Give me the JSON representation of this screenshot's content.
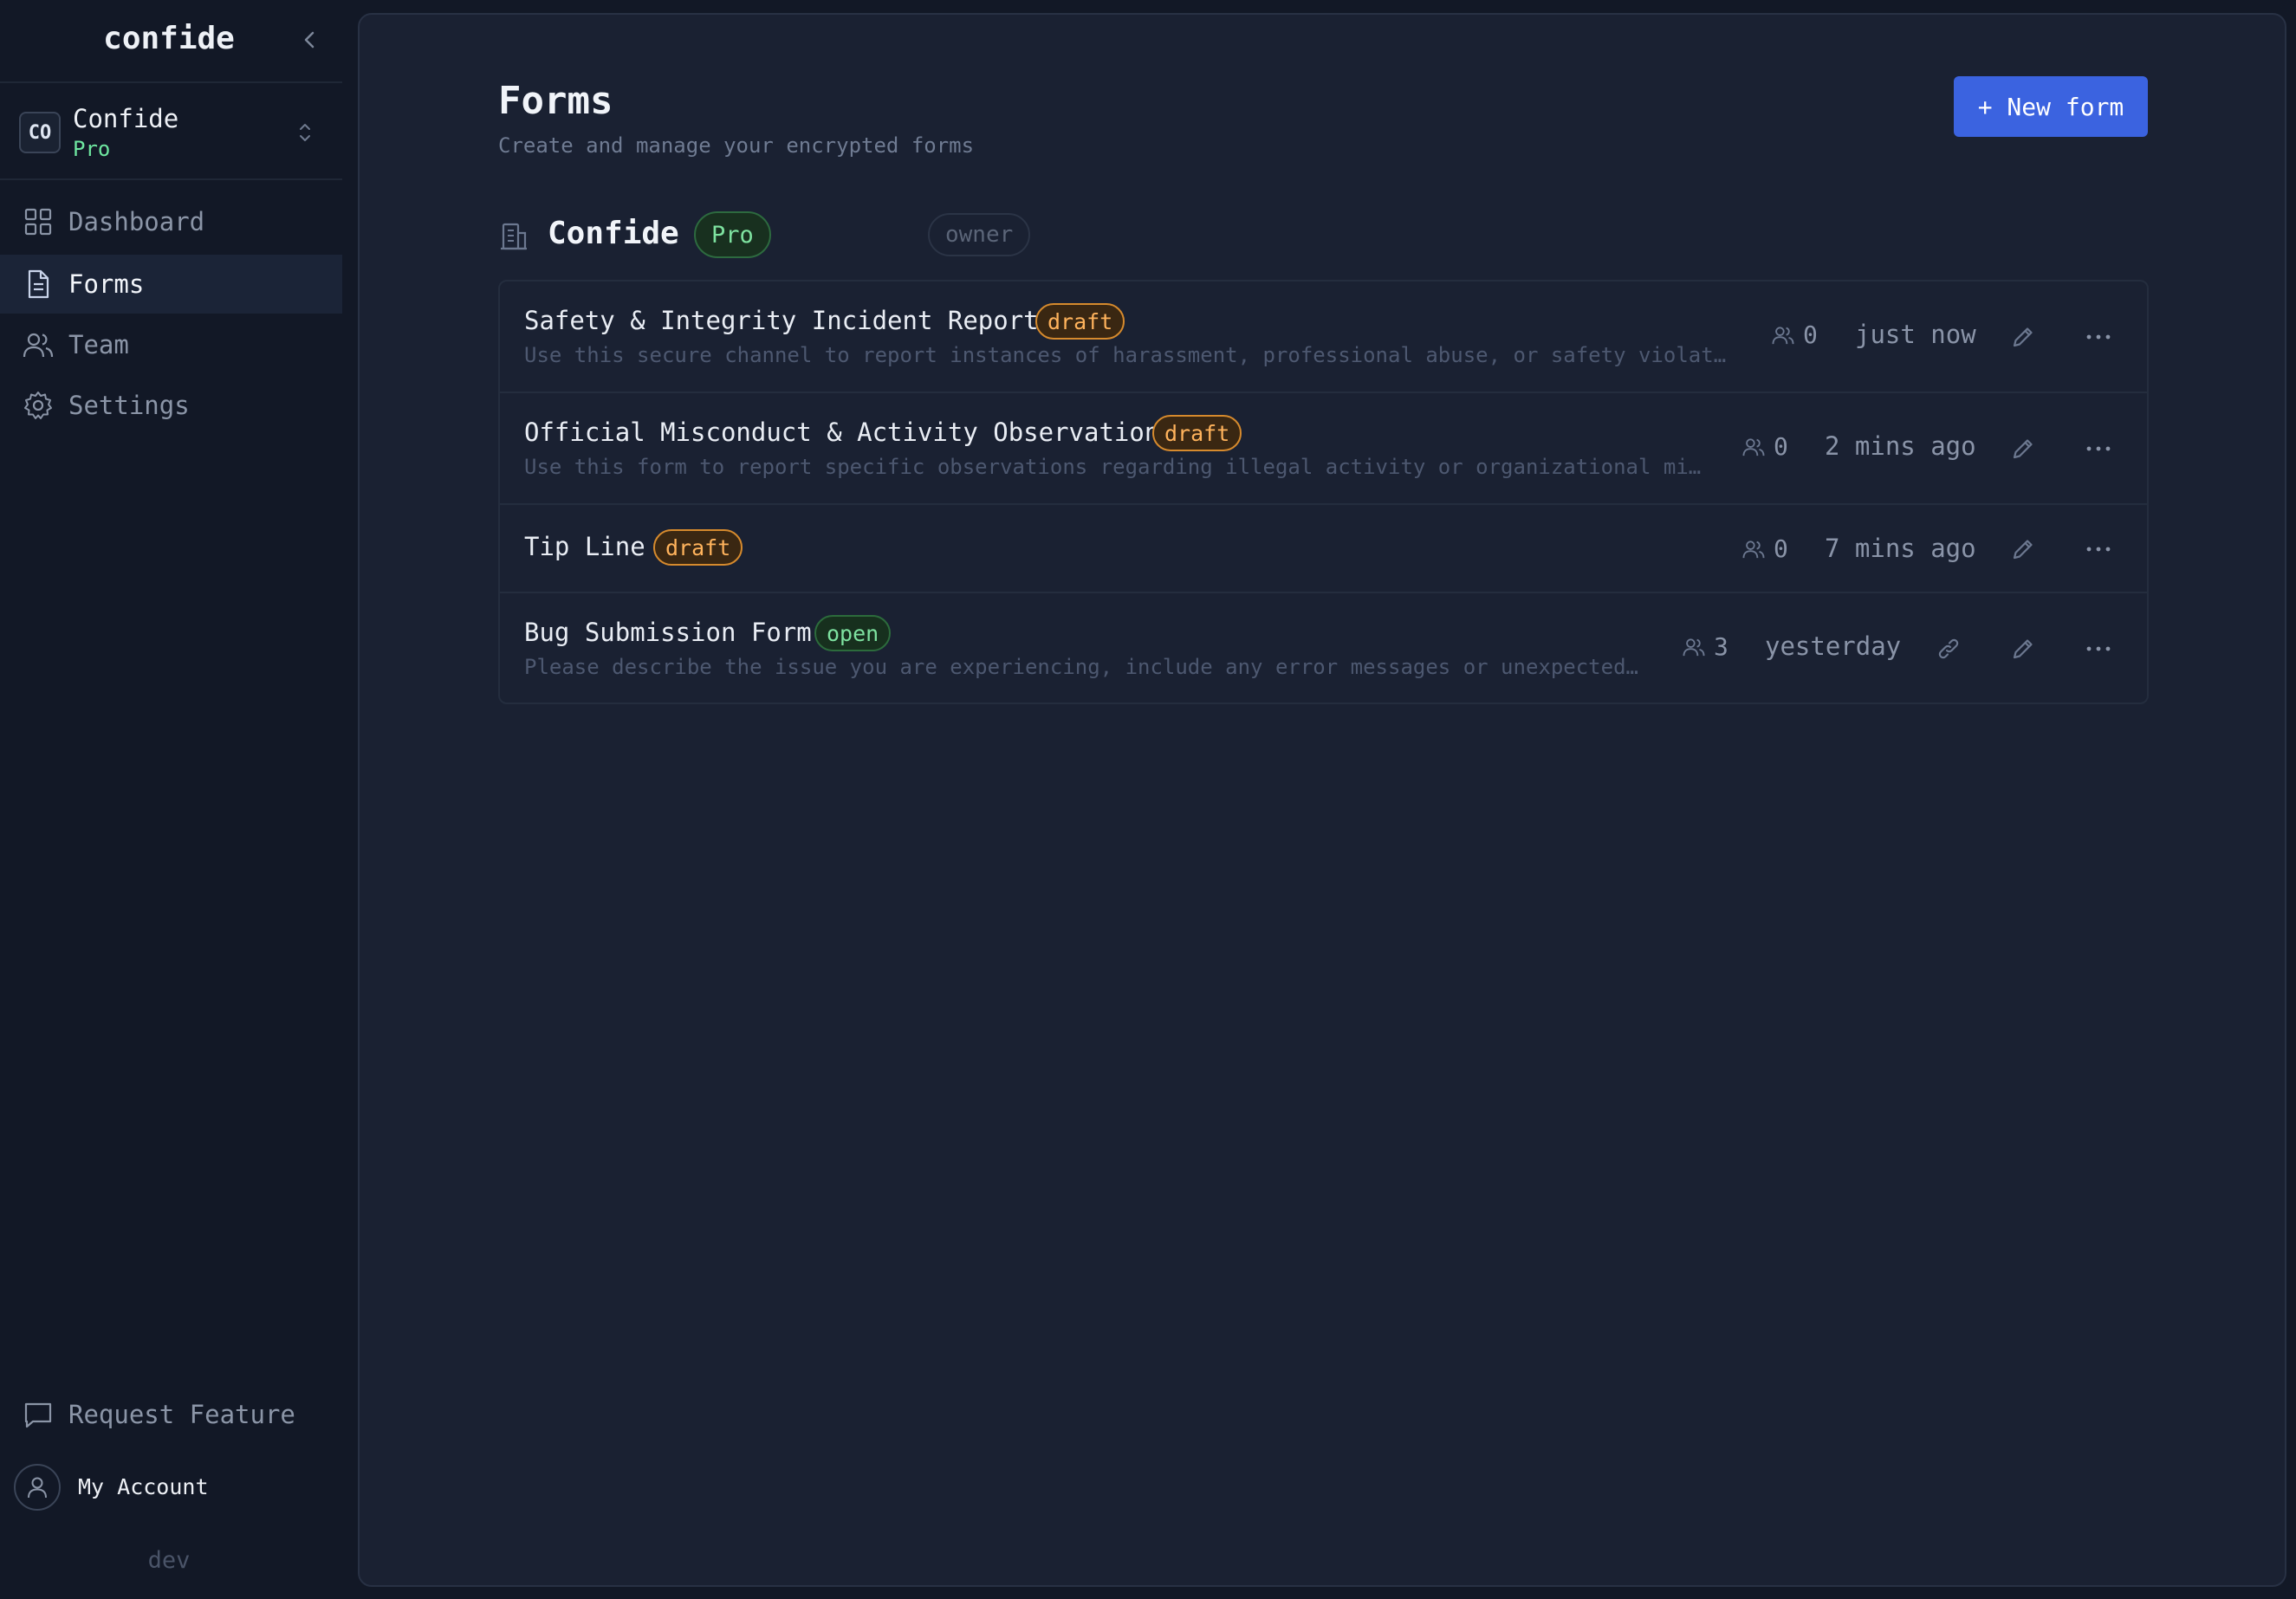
{
  "sidebar": {
    "brand": "confide",
    "org": {
      "initials": "CO",
      "name": "Confide",
      "plan": "Pro"
    },
    "nav": [
      {
        "label": "Dashboard",
        "icon": "grid-icon"
      },
      {
        "label": "Forms",
        "icon": "document-icon",
        "active": true
      },
      {
        "label": "Team",
        "icon": "users-icon"
      },
      {
        "label": "Settings",
        "icon": "gear-icon"
      }
    ],
    "request_feature": "Request Feature",
    "account": "My Account",
    "env": "dev"
  },
  "header": {
    "title": "Forms",
    "subtitle": "Create and manage your encrypted forms",
    "new_form_label": "+ New form"
  },
  "org_section": {
    "name": "Confide",
    "plan_badge": "Pro",
    "role_badge": "owner"
  },
  "forms": [
    {
      "title": "Safety & Integrity Incident Report",
      "status": "draft",
      "description": "Use this secure channel to report instances of harassment, professional abuse, or safety violations",
      "responses": "0",
      "updated": "just now"
    },
    {
      "title": "Official Misconduct & Activity Observation",
      "status": "draft",
      "description": "Use this form to report specific observations regarding illegal activity or organizational misconduct",
      "responses": "0",
      "updated": "2 mins ago"
    },
    {
      "title": "Tip Line",
      "status": "draft",
      "description": "",
      "responses": "0",
      "updated": "7 mins ago"
    },
    {
      "title": "Bug Submission Form",
      "status": "open",
      "description": "Please describe the issue you are experiencing, include any error messages or unexpected behavior",
      "responses": "3",
      "updated": "yesterday"
    }
  ],
  "colors": {
    "accent": "#3b63e0",
    "draft": "#ffb35c",
    "open": "#7ee2a0",
    "background": "#1a2132",
    "sidebar": "#121826"
  }
}
